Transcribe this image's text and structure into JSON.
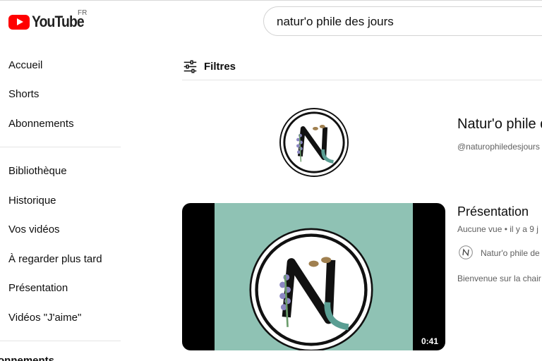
{
  "header": {
    "logo_text": "YouTube",
    "country_code": "FR",
    "search_value": "natur'o phile des jours"
  },
  "sidebar": {
    "items": [
      {
        "label": "Accueil"
      },
      {
        "label": "Shorts"
      },
      {
        "label": "Abonnements"
      },
      {
        "label": "Bibliothèque"
      },
      {
        "label": "Historique"
      },
      {
        "label": "Vos vidéos"
      },
      {
        "label": "À regarder plus tard"
      },
      {
        "label": "Présentation"
      },
      {
        "label": "Vidéos \"J'aime\""
      }
    ],
    "partial_section": "onnements"
  },
  "filters": {
    "label": "Filtres",
    "icon": "filter-sliders-icon"
  },
  "channel_result": {
    "name": "Natur'o phile d",
    "handle": "@naturophiledesjours"
  },
  "video_result": {
    "title": "Présentation",
    "meta": "Aucune vue • il y a 9 j",
    "channel_name": "Natur'o phile de",
    "description": "Bienvenue sur la chair",
    "duration": "0:41"
  },
  "colors": {
    "brand_red": "#ff0000",
    "thumbnail_bg": "#8fc2b4",
    "secondary_text": "#606060"
  }
}
